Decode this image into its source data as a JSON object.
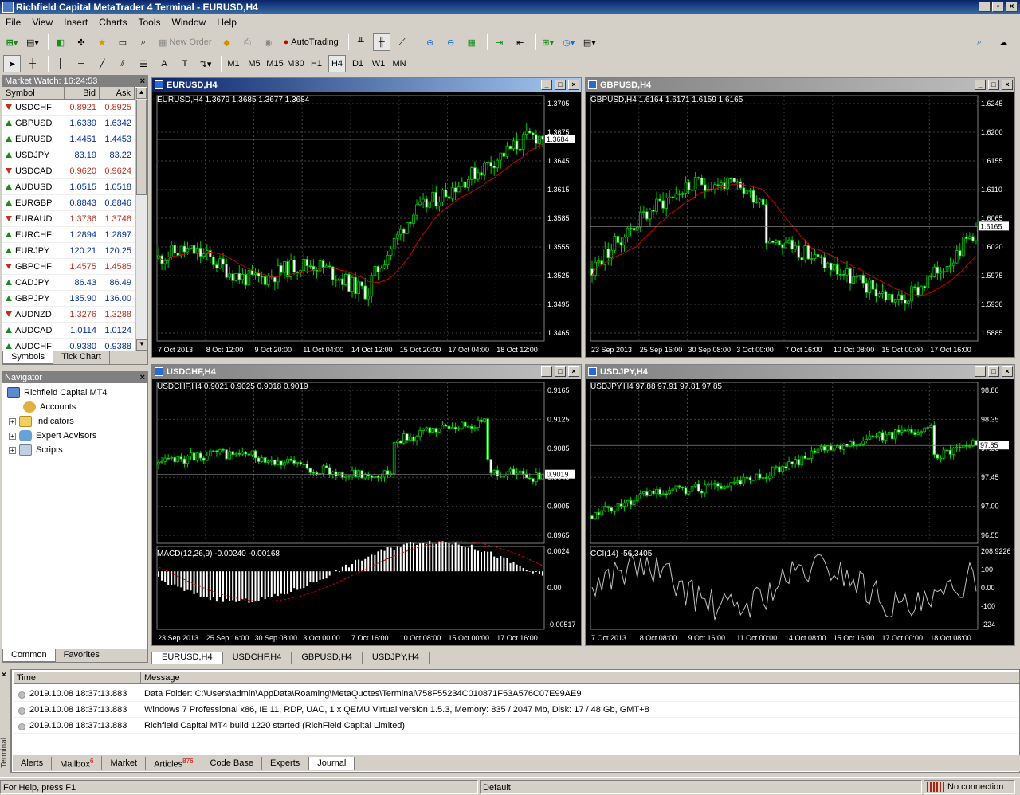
{
  "window": {
    "title": "Richfield Capital MetaTrader 4 Terminal - EURUSD,H4"
  },
  "menu": [
    "File",
    "View",
    "Insert",
    "Charts",
    "Tools",
    "Window",
    "Help"
  ],
  "toolbar": {
    "new_order": "New Order",
    "autotrading": "AutoTrading"
  },
  "timeframes": [
    "M1",
    "M5",
    "M15",
    "M30",
    "H1",
    "H4",
    "D1",
    "W1",
    "MN"
  ],
  "active_timeframe": "H4",
  "market_watch": {
    "title": "Market Watch: 16:24:53",
    "columns": [
      "Symbol",
      "Bid",
      "Ask"
    ],
    "rows": [
      {
        "symbol": "USDCHF",
        "bid": "0.8921",
        "ask": "0.8925",
        "dir": "down"
      },
      {
        "symbol": "GBPUSD",
        "bid": "1.6339",
        "ask": "1.6342",
        "dir": "up"
      },
      {
        "symbol": "EURUSD",
        "bid": "1.4451",
        "ask": "1.4453",
        "dir": "up"
      },
      {
        "symbol": "USDJPY",
        "bid": "83.19",
        "ask": "83.22",
        "dir": "up"
      },
      {
        "symbol": "USDCAD",
        "bid": "0.9620",
        "ask": "0.9624",
        "dir": "down"
      },
      {
        "symbol": "AUDUSD",
        "bid": "1.0515",
        "ask": "1.0518",
        "dir": "up"
      },
      {
        "symbol": "EURGBP",
        "bid": "0.8843",
        "ask": "0.8846",
        "dir": "up"
      },
      {
        "symbol": "EURAUD",
        "bid": "1.3736",
        "ask": "1.3748",
        "dir": "down"
      },
      {
        "symbol": "EURCHF",
        "bid": "1.2894",
        "ask": "1.2897",
        "dir": "up"
      },
      {
        "symbol": "EURJPY",
        "bid": "120.21",
        "ask": "120.25",
        "dir": "up"
      },
      {
        "symbol": "GBPCHF",
        "bid": "1.4575",
        "ask": "1.4585",
        "dir": "down"
      },
      {
        "symbol": "CADJPY",
        "bid": "86.43",
        "ask": "86.49",
        "dir": "up"
      },
      {
        "symbol": "GBPJPY",
        "bid": "135.90",
        "ask": "136.00",
        "dir": "up"
      },
      {
        "symbol": "AUDNZD",
        "bid": "1.3276",
        "ask": "1.3288",
        "dir": "down"
      },
      {
        "symbol": "AUDCAD",
        "bid": "1.0114",
        "ask": "1.0124",
        "dir": "up"
      },
      {
        "symbol": "AUDCHF",
        "bid": "0.9380",
        "ask": "0.9388",
        "dir": "up"
      }
    ],
    "tabs": [
      "Symbols",
      "Tick Chart"
    ]
  },
  "navigator": {
    "title": "Navigator",
    "root": "Richfield Capital MT4",
    "items": [
      "Accounts",
      "Indicators",
      "Expert Advisors",
      "Scripts"
    ],
    "tabs": [
      "Common",
      "Favorites"
    ]
  },
  "charts": [
    {
      "id": "eurusd",
      "title": "EURUSD,H4",
      "ohlc": "EURUSD,H4  1.3679 1.3685 1.3677 1.3684",
      "prices": [
        "1.3705",
        "1.3675",
        "1.3645",
        "1.3615",
        "1.3585",
        "1.3555",
        "1.3525",
        "1.3495",
        "1.3465"
      ],
      "current": "1.3684",
      "dates": [
        "7 Oct 2013",
        "8 Oct 12:00",
        "9 Oct 20:00",
        "11 Oct 04:00",
        "14 Oct 12:00",
        "15 Oct 20:00",
        "17 Oct 04:00",
        "18 Oct 12:00"
      ]
    },
    {
      "id": "gbpusd",
      "title": "GBPUSD,H4",
      "ohlc": "GBPUSD,H4  1.6164 1.6171 1.6159 1.6165",
      "prices": [
        "1.6245",
        "1.6200",
        "1.6155",
        "1.6110",
        "1.6065",
        "1.6020",
        "1.5975",
        "1.5930",
        "1.5885"
      ],
      "current": "1.6165",
      "dates": [
        "23 Sep 2013",
        "25 Sep 16:00",
        "30 Sep 08:00",
        "3 Oct 00:00",
        "7 Oct 16:00",
        "10 Oct 08:00",
        "15 Oct 00:00",
        "17 Oct 16:00"
      ]
    },
    {
      "id": "usdchf",
      "title": "USDCHF,H4",
      "ohlc": "USDCHF,H4  0.9021 0.9025 0.9018 0.9019",
      "prices": [
        "0.9165",
        "0.9125",
        "0.9085",
        "0.9045",
        "0.9005",
        "0.8965"
      ],
      "current": "0.9019",
      "indicator": "MACD(12,26,9) -0.00240 -0.00168",
      "ind_scale": [
        "0.0024",
        "0.00",
        "-0.00517"
      ],
      "dates": [
        "23 Sep 2013",
        "25 Sep 16:00",
        "30 Sep 08:00",
        "3 Oct 00:00",
        "7 Oct 16:00",
        "10 Oct 08:00",
        "15 Oct 00:00",
        "17 Oct 16:00"
      ]
    },
    {
      "id": "usdjpy",
      "title": "USDJPY,H4",
      "ohlc": "USDJPY,H4  97.88 97.91 97.81 97.85",
      "prices": [
        "98.80",
        "98.35",
        "97.90",
        "97.45",
        "97.00",
        "96.55"
      ],
      "current": "97.85",
      "indicator": "CCI(14) -56.3405",
      "ind_scale": [
        "208.9226",
        "100",
        "0.00",
        "-100",
        "-224"
      ],
      "dates": [
        "7 Oct 2013",
        "8 Oct 08:00",
        "9 Oct 16:00",
        "11 Oct 00:00",
        "14 Oct 08:00",
        "15 Oct 16:00",
        "17 Oct 00:00",
        "18 Oct 08:00"
      ]
    }
  ],
  "chart_tabs": [
    "EURUSD,H4",
    "USDCHF,H4",
    "GBPUSD,H4",
    "USDJPY,H4"
  ],
  "terminal": {
    "side_label": "Terminal",
    "columns": [
      "Time",
      "Message"
    ],
    "rows": [
      {
        "time": "2019.10.08 18:37:13.883",
        "msg": "Data Folder: C:\\Users\\admin\\AppData\\Roaming\\MetaQuotes\\Terminal\\758F55234C010871F53A576C07E99AE9"
      },
      {
        "time": "2019.10.08 18:37:13.883",
        "msg": "Windows 7 Professional x86, IE 11, RDP, UAC, 1 x QEMU Virtual  version 1.5.3, Memory: 835 / 2047 Mb, Disk: 17 / 48 Gb, GMT+8"
      },
      {
        "time": "2019.10.08 18:37:13.883",
        "msg": "Richfield Capital MT4 build 1220 started (RichField Capital Limited)"
      }
    ],
    "tabs": [
      {
        "label": "Alerts"
      },
      {
        "label": "Mailbox",
        "badge": "6"
      },
      {
        "label": "Market"
      },
      {
        "label": "Articles",
        "badge": "876"
      },
      {
        "label": "Code Base"
      },
      {
        "label": "Experts"
      },
      {
        "label": "Journal",
        "active": true
      }
    ]
  },
  "status": {
    "help": "For Help, press F1",
    "profile": "Default",
    "connection": "No connection"
  },
  "colors": {
    "bull": "#000000",
    "bear": "#ffffff",
    "wick": "#00cc00",
    "ma": "#cc0000",
    "grid": "#404040"
  }
}
